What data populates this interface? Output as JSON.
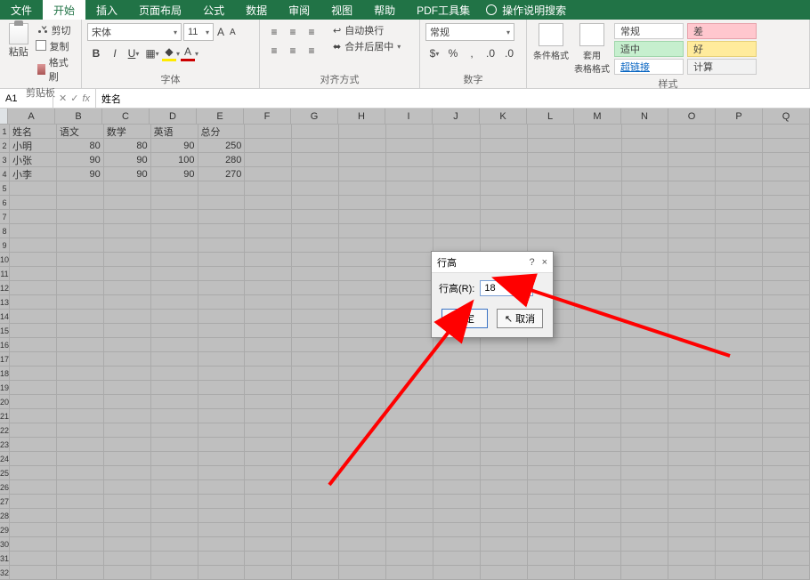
{
  "menu": {
    "file": "文件",
    "tabs": [
      "开始",
      "插入",
      "页面布局",
      "公式",
      "数据",
      "审阅",
      "视图",
      "帮助",
      "PDF工具集"
    ],
    "search": "操作说明搜索"
  },
  "ribbon": {
    "clipboard": {
      "paste": "粘贴",
      "cut": "剪切",
      "copy": "复制",
      "format_painter": "格式刷",
      "label": "剪贴板"
    },
    "font": {
      "name": "宋体",
      "size": "11",
      "bold": "B",
      "italic": "I",
      "underline": "U",
      "label": "字体"
    },
    "align": {
      "wrap": "自动换行",
      "merge": "合并后居中",
      "label": "对齐方式"
    },
    "number": {
      "format": "常规",
      "label": "数字"
    },
    "style": {
      "cond": "条件格式",
      "table": "套用\n表格格式",
      "pills": {
        "normal": "常规",
        "bad": "差",
        "good": "好",
        "mid": "适中",
        "link": "超链接",
        "calc": "计算"
      },
      "label": "样式"
    }
  },
  "formulabar": {
    "namebox": "A1",
    "fx": "fx",
    "value": "姓名"
  },
  "grid": {
    "cols": [
      "A",
      "B",
      "C",
      "D",
      "E",
      "F",
      "G",
      "H",
      "I",
      "J",
      "K",
      "L",
      "M",
      "N",
      "O",
      "P",
      "Q"
    ],
    "rows": [
      {
        "n": "1",
        "cells": [
          "姓名",
          "语文",
          "数学",
          "英语",
          "总分",
          "",
          "",
          "",
          "",
          "",
          "",
          "",
          "",
          "",
          "",
          "",
          ""
        ]
      },
      {
        "n": "2",
        "cells": [
          "小明",
          "80",
          "80",
          "90",
          "250",
          "",
          "",
          "",
          "",
          "",
          "",
          "",
          "",
          "",
          "",
          "",
          ""
        ]
      },
      {
        "n": "3",
        "cells": [
          "小张",
          "90",
          "90",
          "100",
          "280",
          "",
          "",
          "",
          "",
          "",
          "",
          "",
          "",
          "",
          "",
          "",
          ""
        ]
      },
      {
        "n": "4",
        "cells": [
          "小李",
          "90",
          "90",
          "90",
          "270",
          "",
          "",
          "",
          "",
          "",
          "",
          "",
          "",
          "",
          "",
          "",
          ""
        ]
      }
    ],
    "empty_rows": 28
  },
  "dialog": {
    "title": "行高",
    "help": "?",
    "close": "×",
    "label": "行高(R):",
    "value": "18",
    "ok": "确定",
    "cancel": "取消"
  }
}
